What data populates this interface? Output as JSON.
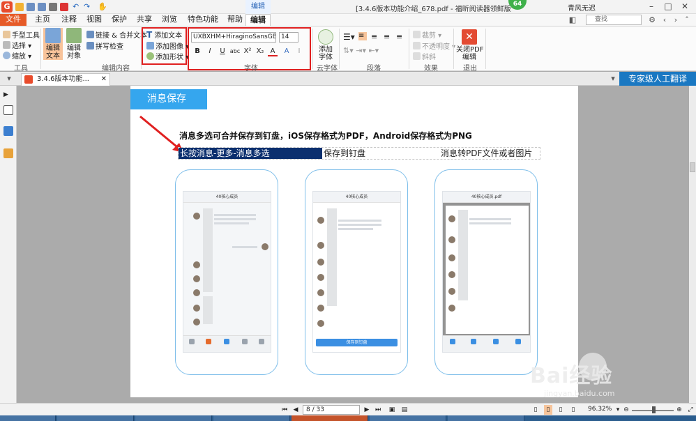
{
  "window": {
    "title": "[3.4.6版本功能介绍_678.pdf - 福昕阅读器领鲜版",
    "context_tab": "编辑",
    "user": "青风无迟",
    "notify_badge": "64",
    "search_placeholder": "查找"
  },
  "menu": {
    "tabs": [
      "文件",
      "主页",
      "注释",
      "视图",
      "保护",
      "共享",
      "浏览",
      "特色功能",
      "帮助",
      "编辑"
    ]
  },
  "ribbon": {
    "tools": {
      "hand": "手型工具",
      "select": "选择",
      "zoom": "缩放",
      "label": "工具"
    },
    "edit_content": {
      "edit_text": "编辑\n文本",
      "edit_object": "编辑\n对象",
      "link_merge": "链接 & 合并文本",
      "spell": "拼写检查",
      "label": "编辑内容"
    },
    "add": {
      "add_text": "添加文本",
      "add_image": "添加图像",
      "add_shape": "添加形状"
    },
    "font": {
      "family": "UXBXHM+HiraginoSansGB-W3",
      "size": "14",
      "label": "字体",
      "buttons": [
        "B",
        "I",
        "U",
        "abc",
        "X²",
        "X₂",
        "A",
        "A",
        "I"
      ]
    },
    "cloud_font": {
      "add_font": "添加\n字体",
      "label": "云字体"
    },
    "paragraph": {
      "label": "段落"
    },
    "effects": {
      "crop": "裁剪",
      "opacity": "不透明度",
      "skew": "斜斜",
      "label": "效果"
    },
    "exit": {
      "close_edit": "关闭PDF\n编辑",
      "label": "退出"
    }
  },
  "docbar": {
    "tab_title": "3.4.6版本功能...",
    "translate": "专家级人工翻译"
  },
  "page": {
    "banner": "消息保存",
    "headline": "消息多选可合并保存到钉盘，iOS保存格式为PDF，Android保存格式为PNG",
    "sub1": "长按消息-更多-消息多选",
    "sub2": "保存到钉盘",
    "sub3": "消息转PDF文件或者图片",
    "phone1_title": "40核心成员",
    "phone2_title": "40核心成员",
    "phone3_title": "40核心成员.pdf",
    "pin_button": "保存到钉盘"
  },
  "statusbar": {
    "page": "8 / 33",
    "zoom": "96.32%"
  },
  "watermark": {
    "text": "Bai经验",
    "url": "jingyan.baidu.com"
  }
}
